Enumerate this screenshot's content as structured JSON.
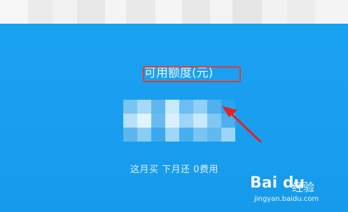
{
  "header": {
    "blurred": true
  },
  "panel": {
    "credit_label": "可用额度(元)",
    "amount_blurred": true,
    "footer_text": "这月买 下月还 0费用",
    "highlight_color": "#e53935",
    "accent_color": "#1aa3f2"
  },
  "watermark": {
    "logo": "Bai du",
    "text": "经验",
    "url": "jingyan.baidu.com"
  }
}
